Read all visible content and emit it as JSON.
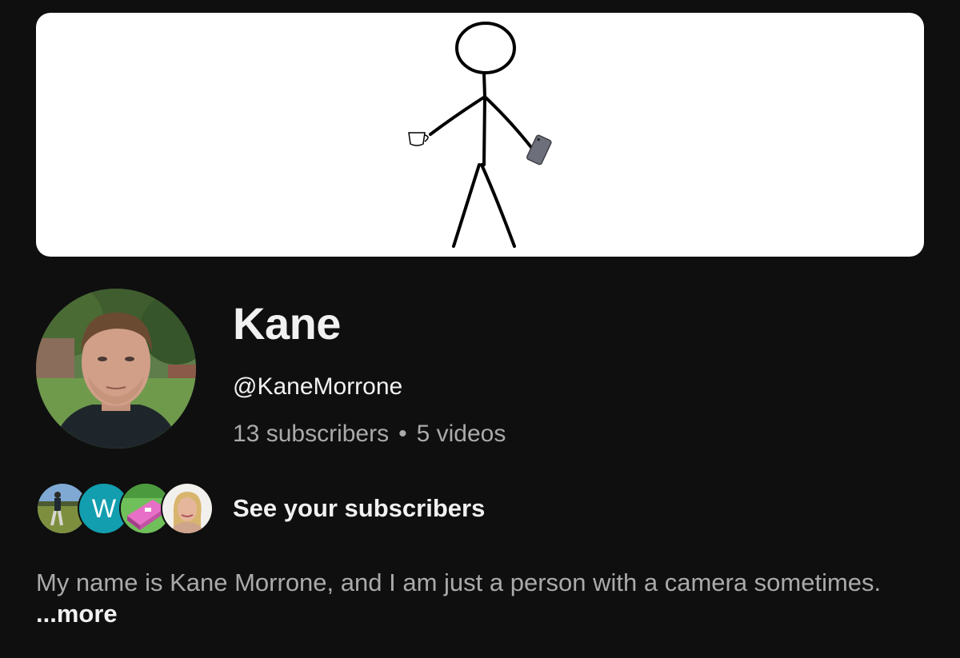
{
  "channel": {
    "name": "Kane",
    "handle": "@KaneMorrone",
    "subscribers": "13 subscribers",
    "separator": "•",
    "videos": "5 videos"
  },
  "subscribers_preview": {
    "label": "See your subscribers",
    "avatars": [
      {
        "type": "photo",
        "icon": "person-walking-on-grass"
      },
      {
        "type": "letter",
        "letter": "W",
        "color": "#129eaf"
      },
      {
        "type": "photo",
        "icon": "pixel-game-scene"
      },
      {
        "type": "photo",
        "icon": "woman-portrait"
      }
    ]
  },
  "description": {
    "text": "My name is Kane Morrone, and I am just a person with a camera sometimes.",
    "more_label": "...more"
  },
  "colors": {
    "background": "#0f0f0f",
    "primary_text": "#f1f1f1",
    "secondary_text": "#aaaaaa",
    "banner_background": "#ffffff"
  }
}
